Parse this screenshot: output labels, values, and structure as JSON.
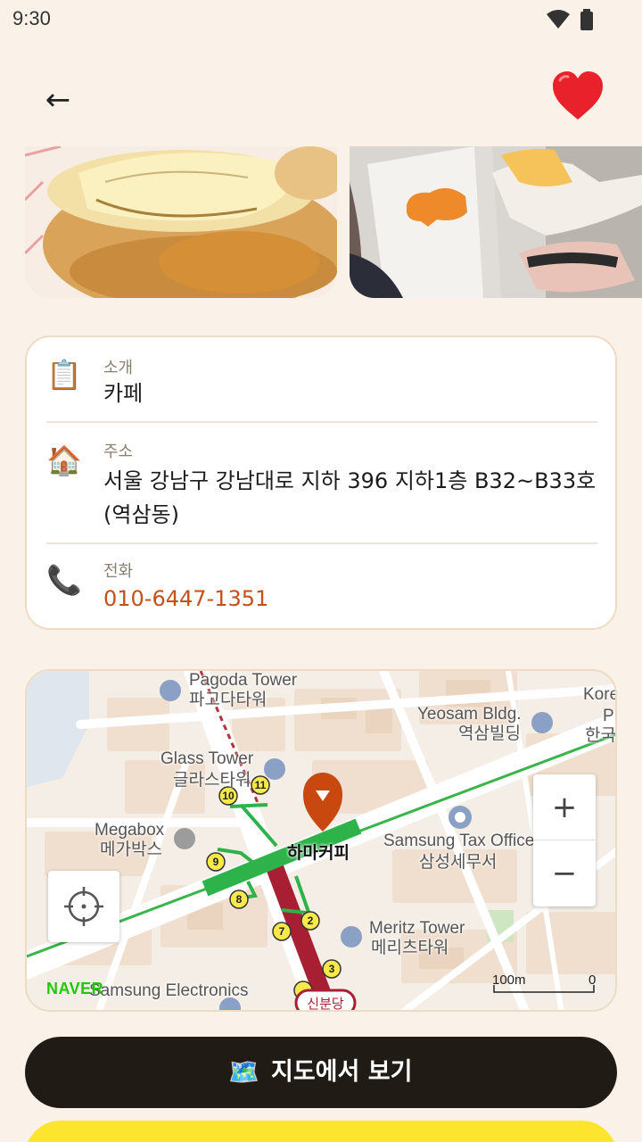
{
  "status_bar": {
    "time": "9:30",
    "wifi_icon": "wifi-icon",
    "battery_icon": "battery-icon"
  },
  "header": {
    "back_label": "←",
    "favorite_icon": "heart-icon",
    "favorite_color": "#e8212b"
  },
  "info": {
    "intro": {
      "icon": "📋",
      "label": "소개",
      "value": "카페"
    },
    "address": {
      "icon": "🏠",
      "label": "주소",
      "value": "서울 강남구 강남대로 지하 396 지하1층 B32~B33호 (역삼동)"
    },
    "phone": {
      "icon": "📞",
      "label": "전화",
      "value": "010-6447-1351"
    }
  },
  "map": {
    "place_name": "하마커피",
    "labels": {
      "pagoda_en": "Pagoda Tower",
      "pagoda_ko": "파고다타워",
      "yeosam_en": "Yeosam Bldg.",
      "yeosam_ko": "역삼빌딩",
      "glass_en": "Glass Tower",
      "glass_ko": "글라스타워",
      "megabox_en": "Megabox",
      "megabox_ko": "메가박스",
      "samsung_tax_en": "Samsung Tax Office",
      "samsung_tax_ko": "삼성세무서",
      "meritz_en": "Meritz Tower",
      "meritz_ko": "메리츠타워",
      "samsung_elec": "Samsung Electronics",
      "kore_partial": "Kore",
      "pr_partial": "Pr",
      "hanguk_partial": "한국",
      "station": "신분당"
    },
    "exit_numbers": [
      "10",
      "11",
      "9",
      "8",
      "7",
      "2",
      "3"
    ],
    "zoom_in_label": "+",
    "zoom_out_label": "−",
    "logo": "NAVER",
    "scale_label": "100m",
    "scale_zero": "0",
    "accent_marker_color": "#c9480f"
  },
  "actions": {
    "view_map_icon": "🗺️",
    "view_map_label": "지도에서 보기"
  },
  "colors": {
    "background": "#faf2e8",
    "card_border": "#ecdcc6",
    "phone_text": "#c4501a",
    "dark_button": "#211b16",
    "yellow_button": "#fde52d"
  }
}
